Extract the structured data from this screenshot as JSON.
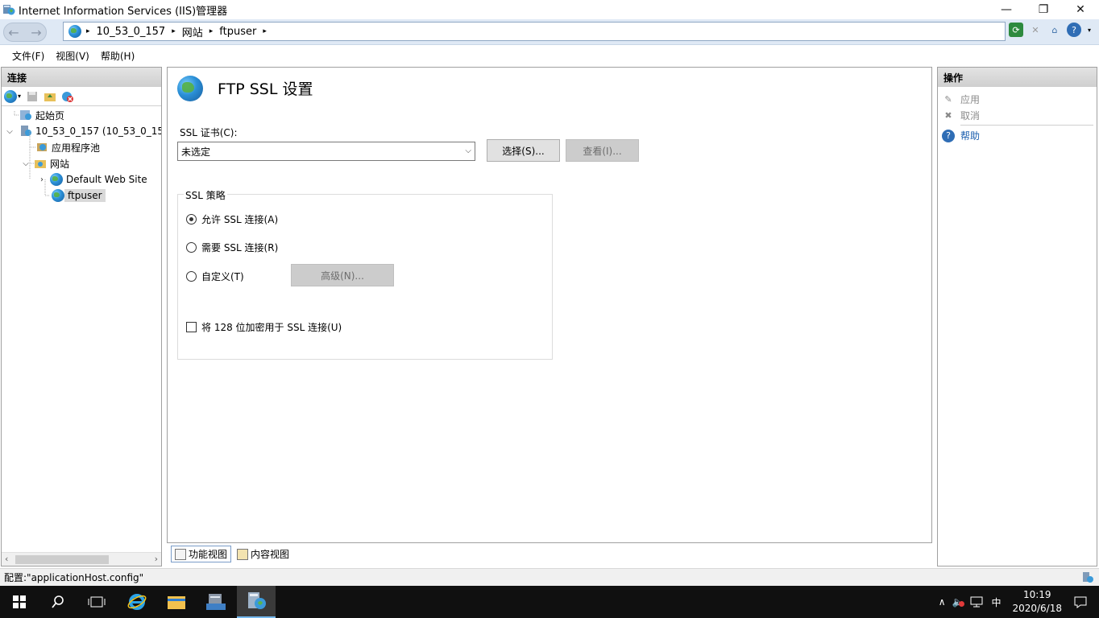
{
  "window": {
    "title": "Internet Information Services (IIS)管理器",
    "controls": {
      "minimize": "—",
      "restore": "❐",
      "close": "✕"
    }
  },
  "address": {
    "back": "←",
    "forward": "→",
    "crumbs": [
      "10_53_0_157",
      "网站",
      "ftpuser"
    ],
    "separator": "▸"
  },
  "menu": {
    "file": "文件(F)",
    "view": "视图(V)",
    "help": "帮助(H)"
  },
  "connections": {
    "header": "连接",
    "tree": {
      "start_page": "起始页",
      "server": "10_53_0_157 (10_53_0_157\\",
      "app_pools": "应用程序池",
      "sites": "网站",
      "default_site": "Default Web Site",
      "ftpuser": "ftpuser"
    }
  },
  "main": {
    "title": "FTP SSL 设置",
    "ssl_cert_label": "SSL 证书(C):",
    "ssl_cert_value": "未选定",
    "select_button": "选择(S)...",
    "view_button": "查看(I)...",
    "policy_group": "SSL 策略",
    "allow_ssl": "允许 SSL 连接(A)",
    "require_ssl": "需要 SSL 连接(R)",
    "custom": "自定义(T)",
    "advanced_button": "高级(N)...",
    "use_128bit": "将 128 位加密用于 SSL 连接(U)",
    "selected_policy": "allow"
  },
  "view_tabs": {
    "features": "功能视图",
    "content": "内容视图"
  },
  "actions": {
    "header": "操作",
    "apply": "应用",
    "cancel": "取消",
    "help": "帮助"
  },
  "status": {
    "text": "配置:\"applicationHost.config\""
  },
  "taskbar": {
    "time": "10:19",
    "date": "2020/6/18",
    "ime": "中"
  },
  "colors": {
    "accent": "#1a5eae",
    "taskbar": "#101010"
  }
}
